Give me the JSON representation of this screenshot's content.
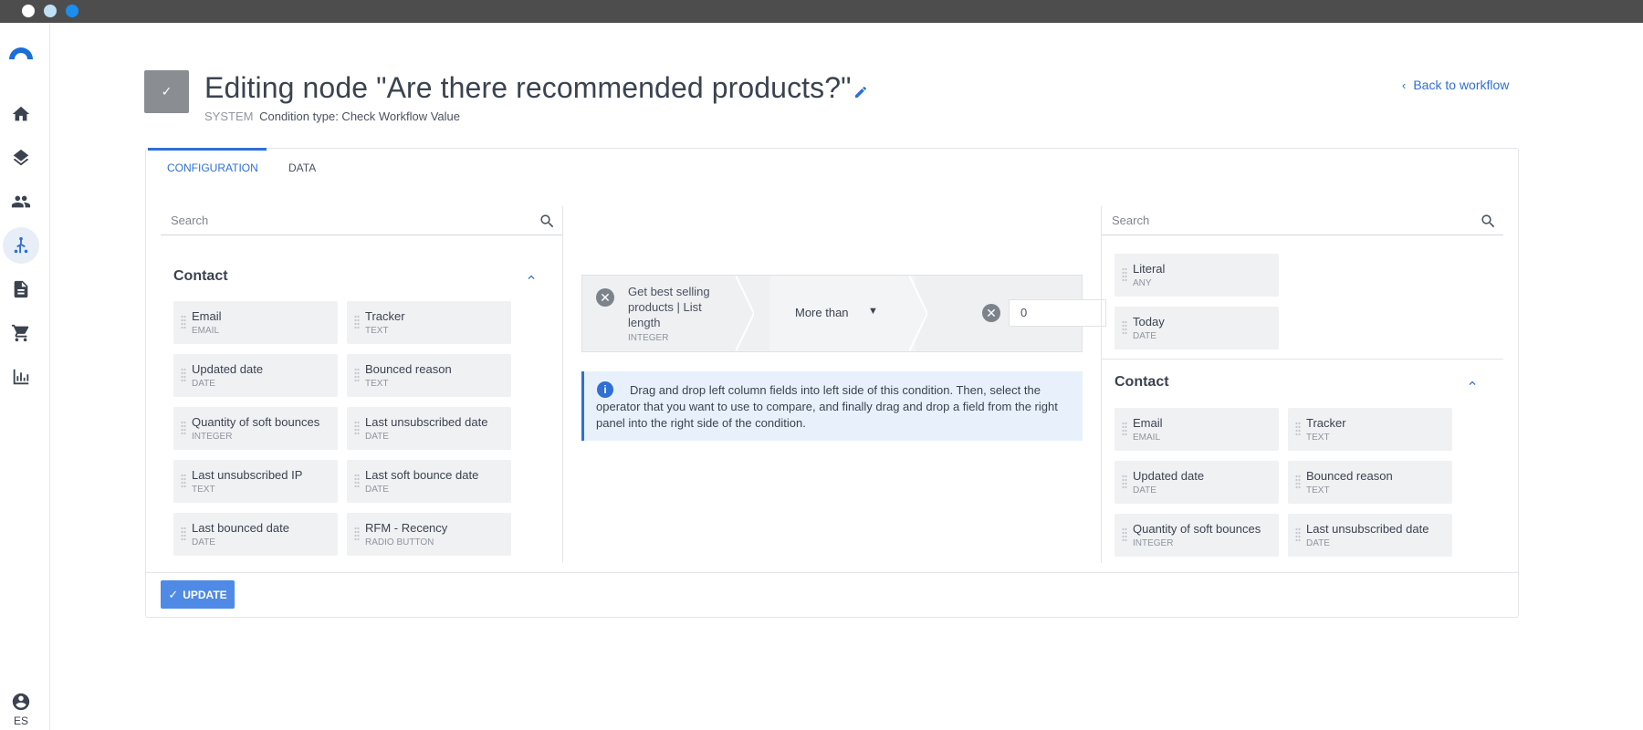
{
  "window": {
    "controls": [
      "close-dot",
      "minimize-dot",
      "maximize-dot"
    ]
  },
  "sidebar": {
    "items": [
      {
        "name": "home-icon"
      },
      {
        "name": "layers-icon"
      },
      {
        "name": "contacts-icon"
      },
      {
        "name": "workflow-icon",
        "active": true
      },
      {
        "name": "document-icon"
      },
      {
        "name": "cart-icon"
      },
      {
        "name": "reports-icon"
      }
    ],
    "language": "ES"
  },
  "header": {
    "title": "Editing node \"Are there recommended products?\"",
    "subtitle_system": "SYSTEM",
    "subtitle_type": "Condition type: Check Workflow Value",
    "back_label": "Back to workflow"
  },
  "tabs": {
    "configuration": "CONFIGURATION",
    "data": "DATA"
  },
  "left_panel": {
    "search_placeholder": "Search",
    "section_title": "Contact",
    "fields": [
      {
        "name": "Email",
        "type": "EMAIL"
      },
      {
        "name": "Tracker",
        "type": "TEXT"
      },
      {
        "name": "Updated date",
        "type": "DATE"
      },
      {
        "name": "Bounced reason",
        "type": "TEXT"
      },
      {
        "name": "Quantity of soft bounces",
        "type": "INTEGER"
      },
      {
        "name": "Last unsubscribed date",
        "type": "DATE"
      },
      {
        "name": "Last unsubscribed IP",
        "type": "TEXT"
      },
      {
        "name": "Last soft bounce date",
        "type": "DATE"
      },
      {
        "name": "Last bounced date",
        "type": "DATE"
      },
      {
        "name": "RFM - Recency",
        "type": "RADIO BUTTON"
      }
    ]
  },
  "condition": {
    "left_field": "Get best selling products | List length",
    "left_type": "INTEGER",
    "operator": "More than",
    "right_value": "0"
  },
  "info": {
    "text": "Drag and drop left column fields into left side of this condition. Then, select the operator that you want to use to compare, and finally drag and drop a field from the right panel into the right side of the condition."
  },
  "right_panel": {
    "search_placeholder": "Search",
    "literals": [
      {
        "name": "Literal",
        "type": "ANY"
      },
      {
        "name": "Today",
        "type": "DATE"
      }
    ],
    "section_title": "Contact",
    "fields": [
      {
        "name": "Email",
        "type": "EMAIL"
      },
      {
        "name": "Tracker",
        "type": "TEXT"
      },
      {
        "name": "Updated date",
        "type": "DATE"
      },
      {
        "name": "Bounced reason",
        "type": "TEXT"
      },
      {
        "name": "Quantity of soft bounces",
        "type": "INTEGER"
      },
      {
        "name": "Last unsubscribed date",
        "type": "DATE"
      }
    ]
  },
  "footer": {
    "update_label": "UPDATE"
  },
  "colors": {
    "accent": "#2f6fd6",
    "button": "#4f8ae6",
    "field_bg": "#f0f1f3",
    "info_bg": "#e8f1fb"
  }
}
